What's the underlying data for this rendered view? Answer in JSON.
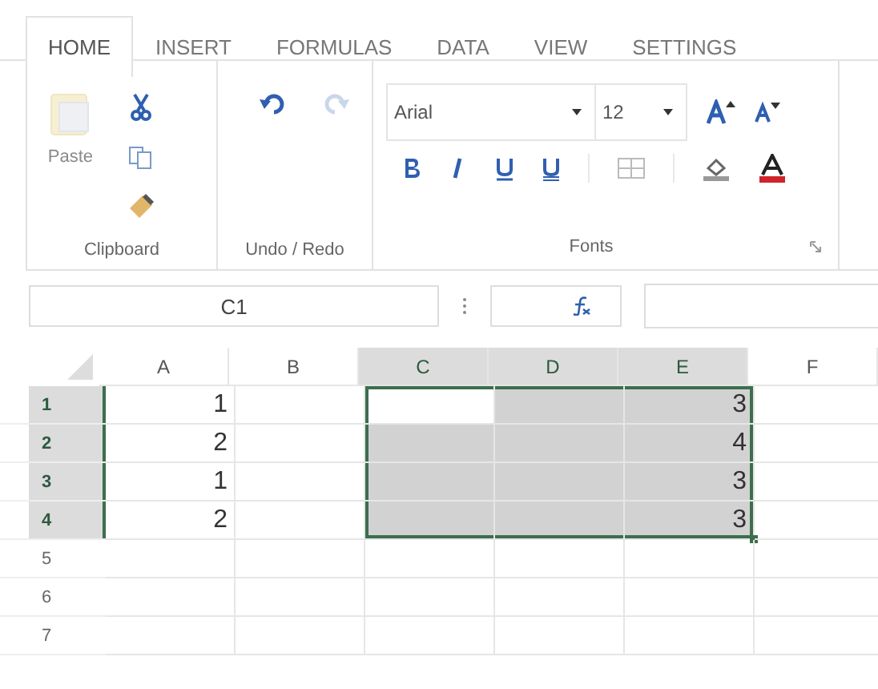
{
  "tabs": [
    {
      "label": "HOME",
      "selected": true
    },
    {
      "label": "INSERT",
      "selected": false
    },
    {
      "label": "FORMULAS",
      "selected": false
    },
    {
      "label": "DATA",
      "selected": false
    },
    {
      "label": "VIEW",
      "selected": false
    },
    {
      "label": "SETTINGS",
      "selected": false
    }
  ],
  "ribbon": {
    "clipboard": {
      "label": "Clipboard",
      "paste": {
        "label": "Paste",
        "disabled": true
      }
    },
    "undo_redo": {
      "label": "Undo / Redo",
      "undo_disabled": false,
      "redo_disabled": true
    },
    "fonts": {
      "label": "Fonts",
      "font": "Arial",
      "size": "12"
    }
  },
  "formula_bar": {
    "name_box": "C1"
  },
  "grid": {
    "columns": [
      {
        "label": "A",
        "selected": false
      },
      {
        "label": "B",
        "selected": false
      },
      {
        "label": "C",
        "selected": true
      },
      {
        "label": "D",
        "selected": true
      },
      {
        "label": "E",
        "selected": true
      },
      {
        "label": "F",
        "selected": false
      }
    ],
    "rows": [
      {
        "label": "1",
        "selected": true,
        "cells": [
          {
            "value": "1",
            "selected": false
          },
          {
            "selected": false
          },
          {
            "selected": true
          },
          {
            "selected": true
          },
          {
            "value": "3",
            "selected": true
          },
          {
            "selected": false
          }
        ]
      },
      {
        "label": "2",
        "selected": true,
        "cells": [
          {
            "value": "2",
            "selected": false
          },
          {
            "selected": false
          },
          {
            "selected": true
          },
          {
            "selected": true
          },
          {
            "value": "4",
            "selected": true
          },
          {
            "selected": false
          }
        ]
      },
      {
        "label": "3",
        "selected": true,
        "cells": [
          {
            "value": "1",
            "selected": false
          },
          {
            "selected": false
          },
          {
            "selected": true
          },
          {
            "selected": true
          },
          {
            "value": "3",
            "selected": true
          },
          {
            "selected": false
          }
        ]
      },
      {
        "label": "4",
        "selected": true,
        "cells": [
          {
            "value": "2",
            "selected": false
          },
          {
            "selected": false
          },
          {
            "selected": true
          },
          {
            "selected": true
          },
          {
            "value": "3",
            "selected": true
          },
          {
            "selected": false
          }
        ]
      },
      {
        "label": "5",
        "selected": false,
        "cells": [
          {
            "selected": false
          },
          {
            "selected": false
          },
          {
            "selected": false
          },
          {
            "selected": false
          },
          {
            "selected": false
          },
          {
            "selected": false
          }
        ]
      },
      {
        "label": "6",
        "selected": false,
        "cells": [
          {
            "selected": false
          },
          {
            "selected": false
          },
          {
            "selected": false
          },
          {
            "selected": false
          },
          {
            "selected": false
          },
          {
            "selected": false
          }
        ]
      },
      {
        "label": "7",
        "selected": false,
        "cells": [
          {
            "selected": false
          },
          {
            "selected": false
          },
          {
            "selected": false
          },
          {
            "selected": false
          },
          {
            "selected": false
          },
          {
            "selected": false
          }
        ]
      }
    ]
  }
}
